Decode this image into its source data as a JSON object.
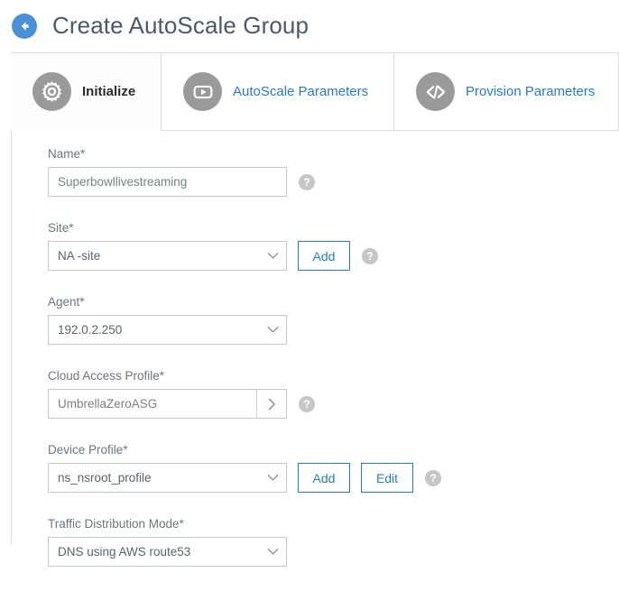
{
  "header": {
    "back_icon": "arrow-left-circle-icon",
    "title": "Create AutoScale Group"
  },
  "tabs": [
    {
      "label": "Initialize",
      "icon": "gear-icon",
      "active": true
    },
    {
      "label": "AutoScale Parameters",
      "icon": "play-square-icon",
      "active": false
    },
    {
      "label": "Provision Parameters",
      "icon": "code-icon",
      "active": false
    }
  ],
  "form": {
    "fields": [
      {
        "label": "Name*",
        "type": "text",
        "value": "Superbowllivestreaming",
        "placeholder": "",
        "help": "?"
      },
      {
        "label": "Site*",
        "type": "select",
        "value": "NA -site",
        "buttons": [
          "Add"
        ],
        "help": "?"
      },
      {
        "label": "Agent*",
        "type": "select",
        "value": "192.0.2.250",
        "buttons": [],
        "help": ""
      },
      {
        "label": "Cloud Access Profile*",
        "type": "combo",
        "value": "UmbrellaZeroASG",
        "combo_icon": "chevron-right-icon",
        "help": "?"
      },
      {
        "label": "Device Profile*",
        "type": "select",
        "value": "ns_nsroot_profile",
        "buttons": [
          "Add",
          "Edit"
        ],
        "help": "?"
      },
      {
        "label": "Traffic Distribution Mode*",
        "type": "select",
        "value": "DNS using AWS route53",
        "buttons": [],
        "help": ""
      }
    ]
  },
  "colors": {
    "accent": "#1f7fc2",
    "link": "#2a79c4",
    "title": "#4a5a6a",
    "back_button": "#4a90d9",
    "icon_circle": "#9a9a9a",
    "help_circle": "#c6c6c6",
    "border": "#c8c8c8"
  }
}
